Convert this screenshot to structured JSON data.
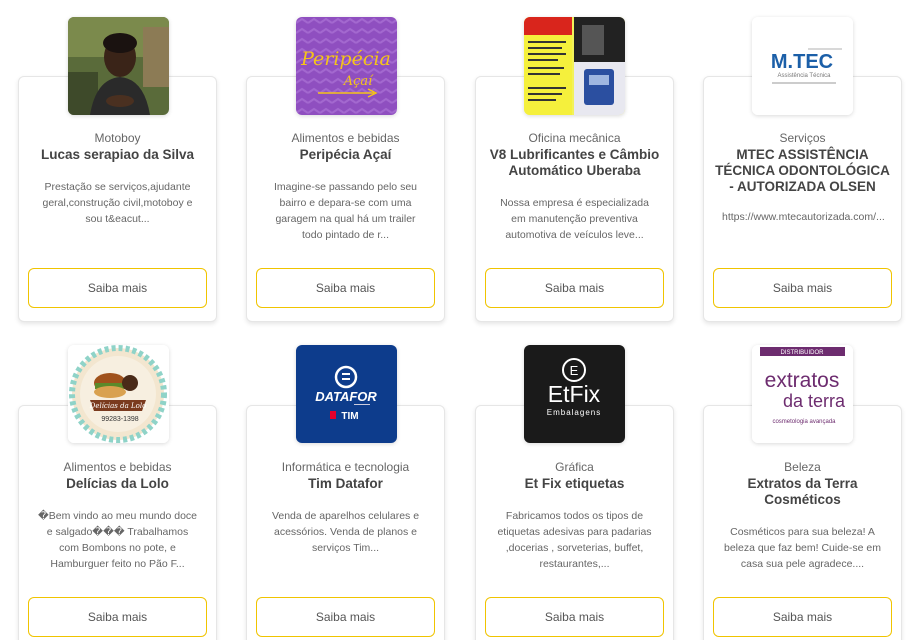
{
  "cards": [
    {
      "category": "Motoboy",
      "title": "Lucas serapiao da Silva",
      "description": "Prestação se serviços,ajudante geral,construção civil,motoboy e sou t&eacut...",
      "button": "Saiba mais"
    },
    {
      "category": "Alimentos e bebidas",
      "title": "Peripécia Açaí",
      "description": "Imagine-se passando pelo seu bairro e depara-se com uma garagem na qual há um trailer todo pintado de r...",
      "button": "Saiba mais",
      "logo_text": "Peripécia",
      "logo_subtext": "Açaí"
    },
    {
      "category": "Oficina mecânica",
      "title": "V8 Lubrificantes e Câmbio Automático Uberaba",
      "description": "Nossa empresa é especializada em manutenção preventiva automotiva de veículos leve...",
      "button": "Saiba mais"
    },
    {
      "category": "Serviços",
      "title": "MTEC ASSISTÊNCIA TÉCNICA ODONTOLÓGICA - AUTORIZADA OLSEN",
      "description": "https://www.mtecautorizada.com/...",
      "button": "Saiba mais",
      "logo_text": "M.TEC",
      "logo_subtext": "Assistência Técnica"
    },
    {
      "category": "Alimentos e bebidas",
      "title": "Delícias da Lolo",
      "description": "�Bem vindo ao meu mundo doce e salgado��� Trabalhamos com Bombons no pote, e Hamburguer feito no Pão F...",
      "button": "Saiba mais",
      "logo_text": "Delícias da Lolo",
      "logo_subtext": "99283-1398"
    },
    {
      "category": "Informática e tecnologia",
      "title": "Tim Datafor",
      "description": "Venda de aparelhos celulares e acessórios. Venda de planos e serviços Tim...",
      "button": "Saiba mais",
      "logo_text": "DATAFOR",
      "logo_subtext": "TIM"
    },
    {
      "category": "Gráfica",
      "title": "Et Fix etiquetas",
      "description": "Fabricamos todos os tipos de etiquetas adesivas para padarias ,docerias , sorveterias, buffet, restaurantes,...",
      "button": "Saiba mais",
      "logo_text": "EtFix",
      "logo_subtext": "Embalagens"
    },
    {
      "category": "Beleza",
      "title": "Extratos da Terra Cosméticos",
      "description": "Cosméticos para sua beleza! A beleza que faz bem! Cuide-se em casa sua pele agradece....",
      "button": "Saiba mais",
      "logo_text": "extratos",
      "logo_subtext": "da terra",
      "logo_tagline": "cosmetologia avançada",
      "logo_banner": "DISTRIBUIDOR"
    }
  ],
  "colors": {
    "button_border": "#f0c400",
    "peripecia_bg": "#8f4fc0",
    "peripecia_text": "#f5c418",
    "mtec_blue": "#1b5fa8",
    "tim_blue": "#0d3c8c",
    "etfix_bg": "#1a1a1a",
    "extratos_purple": "#6d2c6f"
  }
}
